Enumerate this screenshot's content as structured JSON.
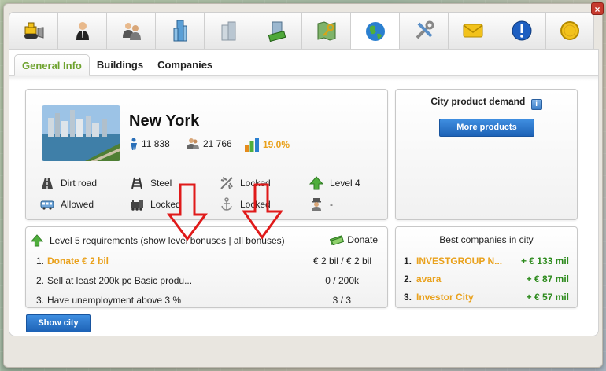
{
  "toolbar": {
    "buttons": [
      {
        "icon": "bulldozer-icon"
      },
      {
        "icon": "businessman-icon"
      },
      {
        "icon": "people-icon"
      },
      {
        "icon": "skyscraper-icon"
      },
      {
        "icon": "buildings-icon"
      },
      {
        "icon": "money-building-icon"
      },
      {
        "icon": "map-key-icon"
      },
      {
        "icon": "globe-icon",
        "active": true
      },
      {
        "icon": "tools-icon"
      },
      {
        "icon": "mail-icon"
      },
      {
        "icon": "info-alert-icon"
      },
      {
        "icon": "coin-icon"
      }
    ],
    "close_label": "×"
  },
  "tabs": [
    "General Info",
    "Buildings",
    "Companies"
  ],
  "city": {
    "name": "New York",
    "inhabitants": "11 838",
    "workers": "21 766",
    "level_percent": "19.0%",
    "attributes": [
      {
        "icon": "road-icon",
        "label": "Dirt road"
      },
      {
        "icon": "rail-icon",
        "label": "Steel"
      },
      {
        "icon": "airplane-icon",
        "label": "Locked"
      },
      {
        "icon": "level-up-arrow-icon",
        "label": "Level 4"
      },
      {
        "icon": "bus-icon",
        "label": "Allowed"
      },
      {
        "icon": "train-icon",
        "label": "Locked"
      },
      {
        "icon": "anchor-icon",
        "label": "Locked"
      },
      {
        "icon": "mayor-icon",
        "label": "-"
      }
    ]
  },
  "demand": {
    "title": "City product demand",
    "button": "More products"
  },
  "requirements": {
    "title": "Level 5 requirements (show level bonuses | all bonuses)",
    "donate": "Donate",
    "rows": [
      {
        "num": "1.",
        "text": "Donate € 2 bil",
        "value": "€ 2 bil / € 2 bil",
        "highlight": true
      },
      {
        "num": "2.",
        "text": "Sell at least 200k pc Basic produ...",
        "value": "0 / 200k"
      },
      {
        "num": "3.",
        "text": "Have unemployment above 3 %",
        "value": "3 / 3"
      }
    ]
  },
  "best": {
    "title": "Best companies in city",
    "rows": [
      {
        "num": "1.",
        "name": "INVESTGROUP N...",
        "value": "+ € 133 mil"
      },
      {
        "num": "2.",
        "name": "avara",
        "value": "+ € 87 mil"
      },
      {
        "num": "3.",
        "name": "Investor City",
        "value": "+ € 57 mil"
      }
    ]
  },
  "show_city_button": "Show city",
  "colors": {
    "accent_green": "#6ea22e",
    "orange": "#e9a11c",
    "positive": "#2c8a1c",
    "button_blue": "#1d62b6",
    "arrow_red": "#e01a1a"
  }
}
